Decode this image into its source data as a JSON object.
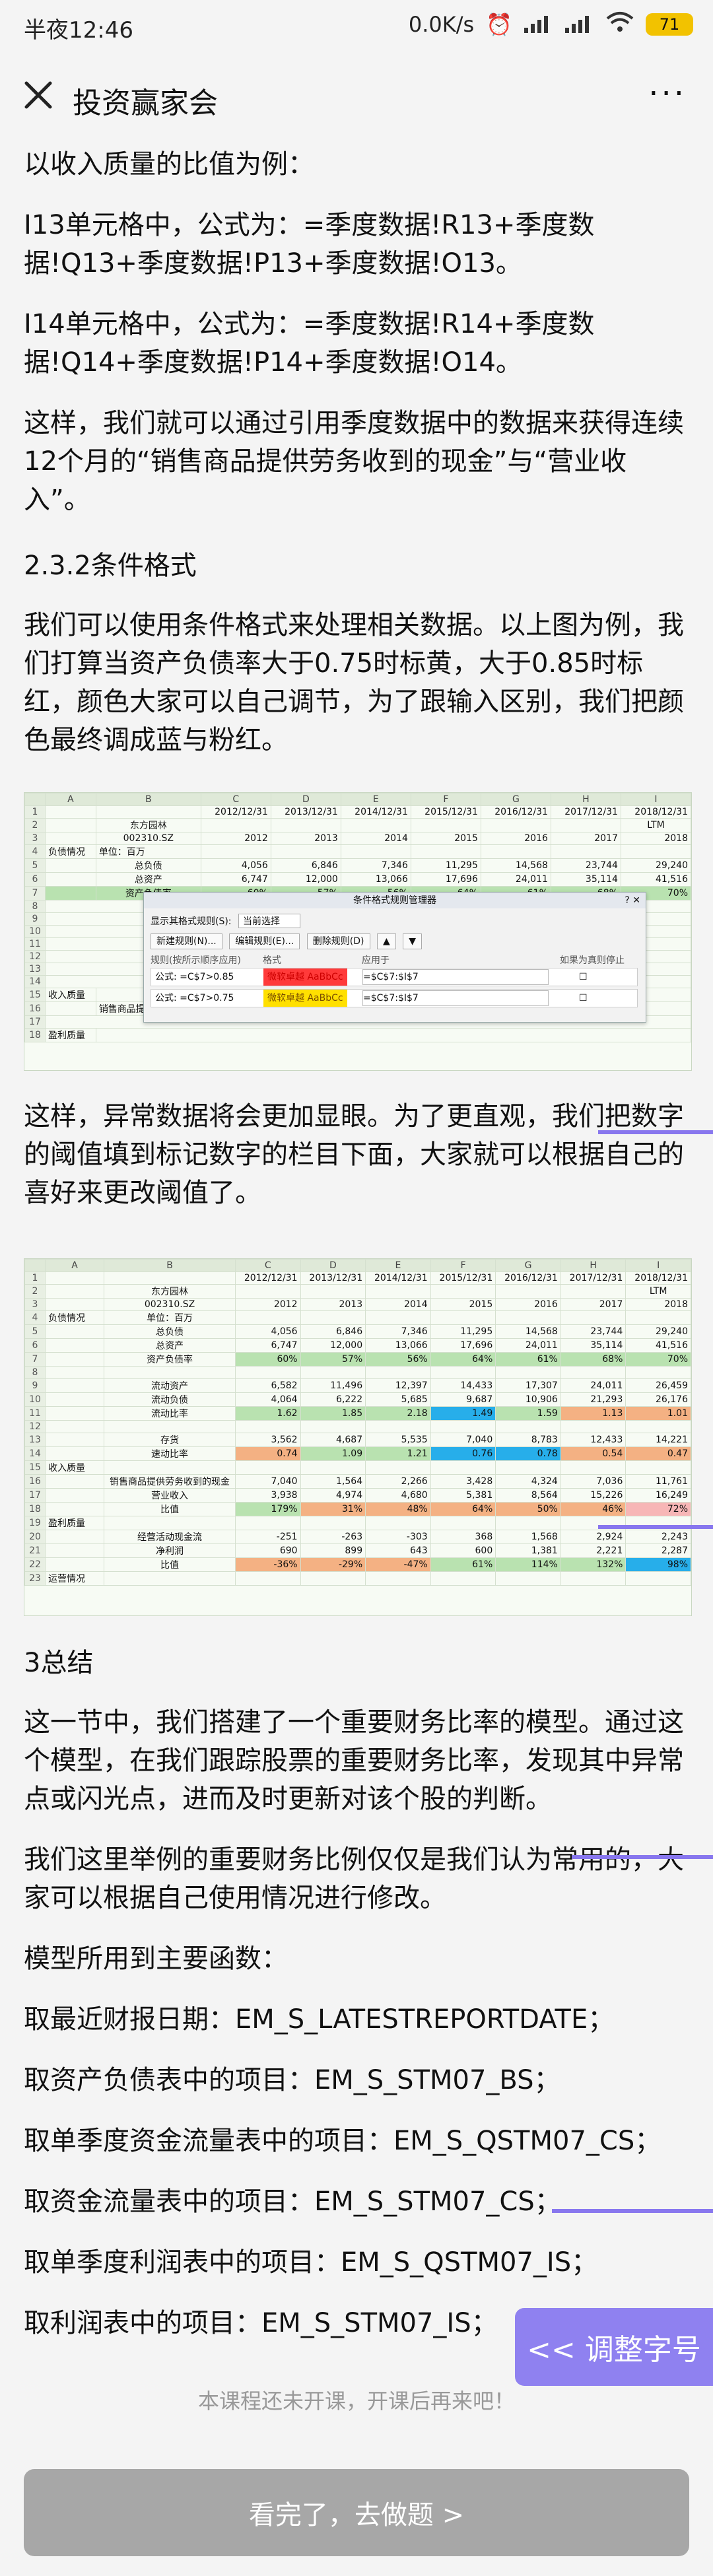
{
  "status": {
    "time": "半夜12:46",
    "speed": "0.0K/s",
    "battery": "71"
  },
  "nav": {
    "title": "投资赢家会",
    "more": "···"
  },
  "article": {
    "p1": "以收入质量的比值为例：",
    "p2": "I13单元格中，公式为：=季度数据!R13+季度数据!Q13+季度数据!P13+季度数据!O13。",
    "p3": "I14单元格中，公式为：=季度数据!R14+季度数据!Q14+季度数据!P14+季度数据!O14。",
    "p4": "这样，我们就可以通过引用季度数据中的数据来获得连续12个月的“销售商品提供劳务收到的现金”与“营业收入”。",
    "h1": "2.3.2条件格式",
    "p5": "我们可以使用条件格式来处理相关数据。以上图为例，我们打算当资产负债率大于0.75时标黄，大于0.85时标红，颜色大家可以自己调节，为了跟输入区别，我们把颜色最终调成蓝与粉红。",
    "p6": "这样，异常数据将会更加显眼。为了更直观，我们把数字的阈值填到标记数字的栏目下面，大家就可以根据自己的喜好来更改阈值了。",
    "h2": "3总结",
    "p7": "这一节中，我们搭建了一个重要财务比率的模型。通过这个模型，在我们跟踪股票的重要财务比率，发现其中异常点或闪光点，进而及时更新对该个股的判断。",
    "p8": "我们这里举例的重要财务比例仅仅是我们认为常用的，大家可以根据自己使用情况进行修改。",
    "p9": "模型所用到主要函数：",
    "p10": "取最近财报日期：EM_S_LATESTREPORTDATE；",
    "p11": "取资产负债表中的项目：EM_S_STM07_BS；",
    "p12": "取单季度资金流量表中的项目：EM_S_QSTM07_CS；",
    "p13": "取资金流量表中的项目：EM_S_STM07_CS；",
    "p14": "取单季度利润表中的项目：EM_S_QSTM07_IS；",
    "p15": "取利润表中的项目：EM_S_STM07_IS；"
  },
  "sheet1": {
    "cols": [
      "A",
      "B",
      "C",
      "D",
      "E",
      "F",
      "G",
      "H",
      "I"
    ],
    "company": "东方园林",
    "code": "002310.SZ",
    "dates": [
      "2012/12/31",
      "2013/12/31",
      "2014/12/31",
      "2015/12/31",
      "2016/12/31",
      "2017/12/31",
      "2018/12/31"
    ],
    "years": [
      "2012",
      "2013",
      "2014",
      "2015",
      "2016",
      "2017",
      "2018"
    ],
    "ltm": "LTM",
    "section": "负债情况",
    "unit": "单位：百万",
    "rows": [
      {
        "label": "总负债",
        "v": [
          "4,056",
          "6,846",
          "7,346",
          "11,295",
          "14,568",
          "23,744",
          "29,240"
        ]
      },
      {
        "label": "总资产",
        "v": [
          "6,747",
          "12,000",
          "13,066",
          "17,696",
          "24,011",
          "35,114",
          "41,516"
        ]
      },
      {
        "label": "资产负债率",
        "v": [
          "60%",
          "57%",
          "56%",
          "64%",
          "61%",
          "68%",
          "70%"
        ]
      }
    ],
    "side_labels": [
      "收入质量",
      "销售商品提供",
      "盈利质量"
    ],
    "dialog": {
      "title": "条件格式规则管理器",
      "show_label": "显示其格式规则(S):",
      "show_value": "当前选择",
      "btn_new": "新建规则(N)...",
      "btn_edit": "编辑规则(E)...",
      "btn_delete": "删除规则(D)",
      "col_rule": "规则(按所示顺序应用)",
      "col_format": "格式",
      "col_apply": "应用于",
      "col_stop": "如果为真则停止",
      "rule1": "公式: =C$7>0.85",
      "rule1_fmt": "微软卓越 AaBbCc",
      "rule1_apply": "=$C$7:$I$7",
      "rule2": "公式: =C$7>0.75",
      "rule2_fmt": "微软卓越 AaBbCc",
      "rule2_apply": "=$C$7:$I$7"
    }
  },
  "sheet2": {
    "rows": [
      {
        "n": "4",
        "a": "负债情况",
        "label": "单位：百万",
        "v": [
          "",
          "",
          "",
          "",
          "",
          "",
          ""
        ]
      },
      {
        "n": "5",
        "a": "",
        "label": "总负债",
        "v": [
          "4,056",
          "6,846",
          "7,346",
          "11,295",
          "14,568",
          "23,744",
          "29,240"
        ]
      },
      {
        "n": "6",
        "a": "",
        "label": "总资产",
        "v": [
          "6,747",
          "12,000",
          "13,066",
          "17,696",
          "24,011",
          "35,114",
          "41,516"
        ]
      },
      {
        "n": "7",
        "a": "",
        "label": "资产负债率",
        "v": [
          "60%",
          "57%",
          "56%",
          "64%",
          "61%",
          "68%",
          "70%"
        ]
      },
      {
        "n": "8",
        "a": "",
        "label": "",
        "v": [
          "",
          "",
          "",
          "",
          "",
          "",
          ""
        ]
      },
      {
        "n": "9",
        "a": "",
        "label": "流动资产",
        "v": [
          "6,582",
          "11,496",
          "12,397",
          "14,433",
          "17,307",
          "24,011",
          "26,459"
        ]
      },
      {
        "n": "10",
        "a": "",
        "label": "流动负债",
        "v": [
          "4,064",
          "6,222",
          "5,685",
          "9,687",
          "10,906",
          "21,293",
          "26,176"
        ]
      },
      {
        "n": "11",
        "a": "",
        "label": "流动比率",
        "v": [
          "1.62",
          "1.85",
          "2.18",
          "1.49",
          "1.59",
          "1.13",
          "1.01"
        ]
      },
      {
        "n": "12",
        "a": "",
        "label": "",
        "v": [
          "",
          "",
          "",
          "",
          "",
          "",
          ""
        ]
      },
      {
        "n": "13",
        "a": "",
        "label": "存货",
        "v": [
          "3,562",
          "4,687",
          "5,535",
          "7,040",
          "8,783",
          "12,433",
          "14,221"
        ]
      },
      {
        "n": "14",
        "a": "",
        "label": "速动比率",
        "v": [
          "0.74",
          "1.09",
          "1.21",
          "0.76",
          "0.78",
          "0.54",
          "0.47"
        ]
      },
      {
        "n": "15",
        "a": "收入质量",
        "label": "",
        "v": [
          "",
          "",
          "",
          "",
          "",
          "",
          ""
        ]
      },
      {
        "n": "16",
        "a": "",
        "label": "销售商品提供劳务收到的现金",
        "v": [
          "7,040",
          "1,564",
          "2,266",
          "3,428",
          "4,324",
          "7,036",
          "11,761"
        ]
      },
      {
        "n": "17",
        "a": "",
        "label": "营业收入",
        "v": [
          "3,938",
          "4,974",
          "4,680",
          "5,381",
          "8,564",
          "15,226",
          "16,249"
        ]
      },
      {
        "n": "18",
        "a": "",
        "label": "比值",
        "v": [
          "179%",
          "31%",
          "48%",
          "64%",
          "50%",
          "46%",
          "72%"
        ]
      },
      {
        "n": "19",
        "a": "盈利质量",
        "label": "",
        "v": [
          "",
          "",
          "",
          "",
          "",
          "",
          ""
        ]
      },
      {
        "n": "20",
        "a": "",
        "label": "经营活动现金流",
        "v": [
          "-251",
          "-263",
          "-303",
          "368",
          "1,568",
          "2,924",
          "2,243"
        ]
      },
      {
        "n": "21",
        "a": "",
        "label": "净利润",
        "v": [
          "690",
          "899",
          "643",
          "600",
          "1,381",
          "2,221",
          "2,287"
        ]
      },
      {
        "n": "22",
        "a": "",
        "label": "比值",
        "v": [
          "-36%",
          "-29%",
          "-47%",
          "61%",
          "114%",
          "132%",
          "98%"
        ]
      },
      {
        "n": "23",
        "a": "运营情况",
        "label": "",
        "v": [
          "",
          "",
          "",
          "",
          "",
          "",
          ""
        ]
      }
    ]
  },
  "footer": {
    "note": "本课程还未开课，开课后再来吧！",
    "button": "看完了，去做题 >",
    "font_size": "<< 调整字号"
  }
}
